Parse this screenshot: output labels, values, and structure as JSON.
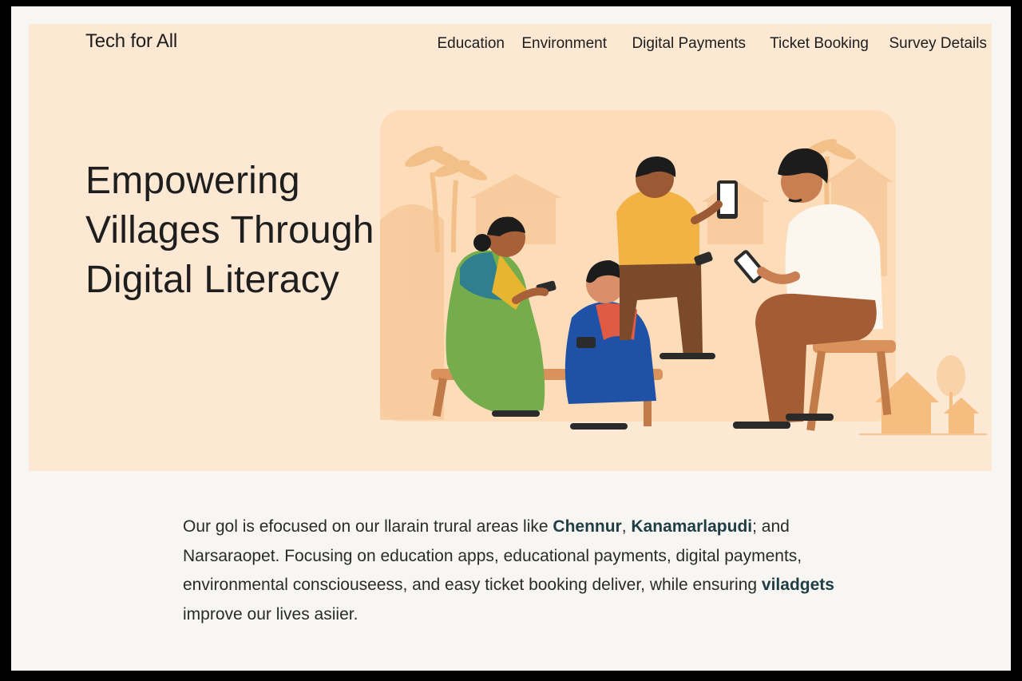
{
  "site": {
    "logo": "Tech for All"
  },
  "nav": {
    "items": [
      {
        "label": "Education"
      },
      {
        "label": "Environment"
      },
      {
        "label": "Digital Payments"
      },
      {
        "label": "Ticket  Booking"
      },
      {
        "label": "Survey Details"
      }
    ]
  },
  "hero": {
    "headline_lines": [
      "Empowering",
      "Villages Through",
      "Digital Literacy"
    ]
  },
  "description": {
    "parts": [
      "Our gol is efocused on our llarain trural areas like ",
      "Chennur",
      ", ",
      "Kanamarlapudi",
      "; and Narsaraopet. Focusing on education apps, educational payments, digital payments, environmental consciouseess, and easy ticket booking deliver, while ensuring ",
      "viladgets",
      " improve our lives asiier."
    ]
  },
  "colors": {
    "hero_bg": "#fde9d3",
    "page_bg": "#f7f6f3",
    "text": "#1e1e1e",
    "accent_text": "#1f3d44"
  },
  "icons": [
    "illustration-villagers-with-phones"
  ]
}
